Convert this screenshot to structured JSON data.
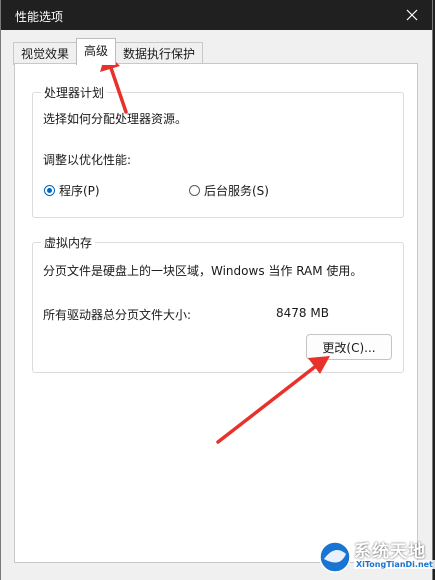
{
  "window": {
    "title": "性能选项"
  },
  "tabs": [
    {
      "label": "视觉效果",
      "active": false
    },
    {
      "label": "高级",
      "active": true
    },
    {
      "label": "数据执行保护",
      "active": false
    }
  ],
  "processor": {
    "legend": "处理器计划",
    "description": "选择如何分配处理器资源。",
    "adjust_label": "调整以优化性能:",
    "option_programs": "程序(P)",
    "option_background": "后台服务(S)",
    "selected": "program"
  },
  "virtual_memory": {
    "legend": "虚拟内存",
    "description": "分页文件是硬盘上的一块区域，Windows 当作 RAM 使用。",
    "total_label": "所有驱动器总分页文件大小:",
    "total_value": "8478 MB",
    "change_button": "更改(C)..."
  },
  "watermark": {
    "title": "系统天地",
    "subtitle": "XiTongTianDi.net"
  },
  "colors": {
    "accent": "#0067c0",
    "arrow": "#e8312b",
    "titlebar": "#202020"
  }
}
